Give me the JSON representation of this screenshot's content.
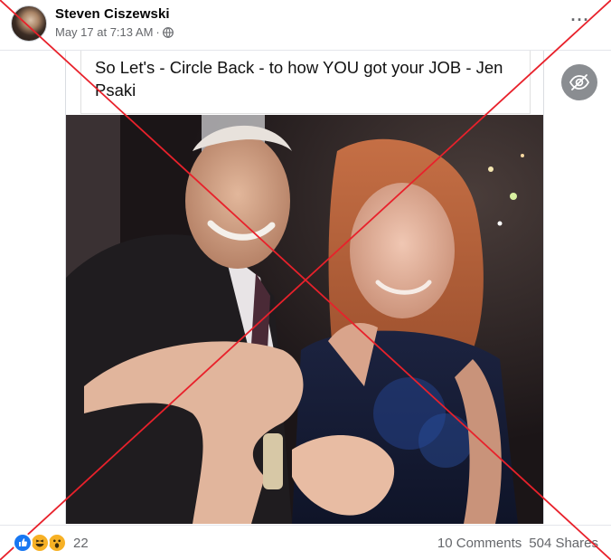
{
  "post": {
    "author": "Steven Ciszewski",
    "timestamp": "May 17 at 7:13 AM",
    "separator": "·",
    "audience_icon": "globe-icon",
    "more_label": "···",
    "caption": "So Let's - Circle Back - to how YOU got your JOB - Jen Psaki"
  },
  "footer": {
    "reaction_icons": [
      "like-icon",
      "haha-icon",
      "wow-icon"
    ],
    "reaction_count": "22",
    "comments": "10 Comments",
    "shares": "504 Shares"
  },
  "overlay": {
    "eye_icon": "eye-slash-icon",
    "fact_check_mark_color": "#e8212b"
  },
  "colors": {
    "like_blue": "#1877f2",
    "emoji_yellow": "#f7b125",
    "secondary_text": "#65676b",
    "eye_button_bg": "#8a8d91"
  }
}
